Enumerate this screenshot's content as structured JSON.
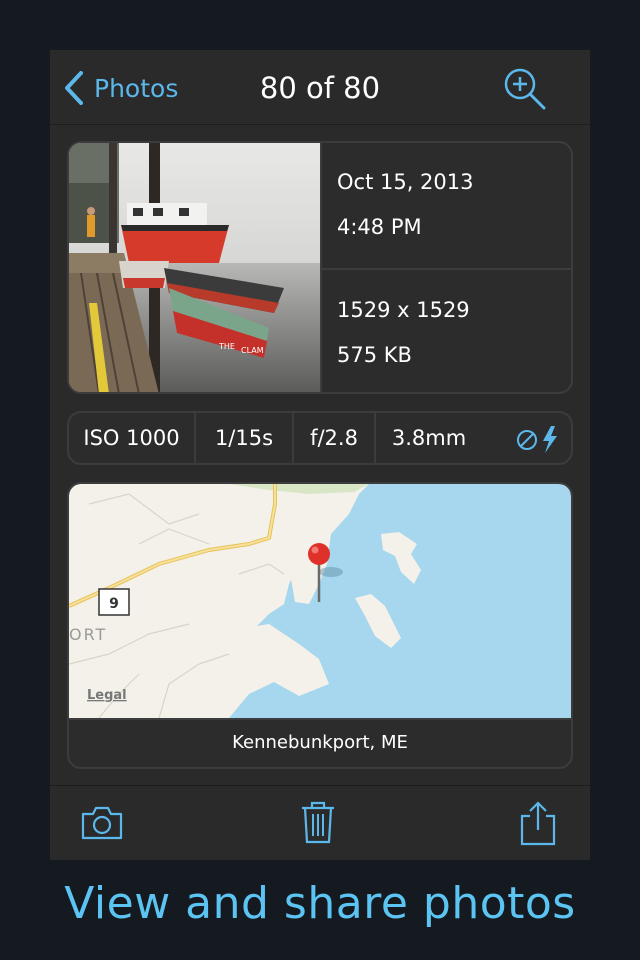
{
  "nav": {
    "back_label": "Photos",
    "title": "80 of 80",
    "zoom_icon": "zoom-in-icon"
  },
  "photo": {
    "date": "Oct 15, 2013",
    "time": "4:48 PM",
    "dimensions": "1529 x 1529",
    "file_size": "575 KB",
    "boat_label_left": "THE",
    "boat_label_right": "CLAM"
  },
  "exif": {
    "iso": "ISO 1000",
    "shutter": "1/15s",
    "aperture": "f/2.8",
    "focal_length": "3.8mm",
    "flash_icon": "flash-off-icon"
  },
  "map": {
    "route_shield": "9",
    "town_fragment": "ORT",
    "legal_label": "Legal",
    "location": "Kennebunkport, ME"
  },
  "toolbar": {
    "camera_icon": "camera-icon",
    "trash_icon": "trash-icon",
    "share_icon": "share-icon"
  },
  "tagline": "View and share photos",
  "colors": {
    "accent": "#5cb8ea",
    "background": "#141a20",
    "panel": "#2a2a2b",
    "water": "#a6d7ee",
    "land": "#f4f1ea",
    "pin": "#e0302a"
  }
}
